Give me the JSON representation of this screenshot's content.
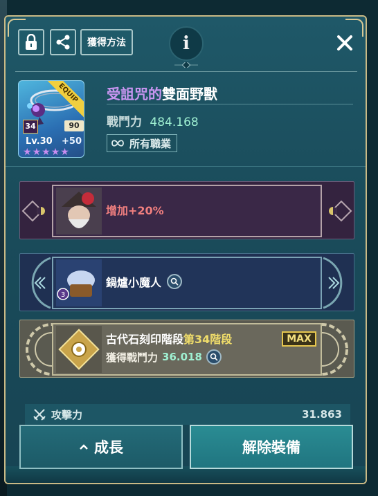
{
  "toolbar": {
    "acquire_label": "獲得方法",
    "info_label": "i"
  },
  "item": {
    "name_cursed": "受詛咒的",
    "name_rest": "雙面野獸",
    "power_label": "戰鬥力",
    "power_value": "484.168",
    "class_label": "所有職業",
    "level_badge": "34",
    "upgrade_badge": "90",
    "level_text": "Lv.30",
    "plus_text": "+50",
    "equip_ribbon": "EQUIP",
    "stars": 5
  },
  "bars": {
    "bonus_text": "增加+20%",
    "pet_name": "鍋爐小魔人",
    "pet_level": "3",
    "stage_prefix": "古代石刻印階段",
    "stage_highlight": "第34階段",
    "max_label": "MAX",
    "gain_label": "獲得戰鬥力",
    "gain_value": "36.018"
  },
  "stats": {
    "attack_label": "攻擊力",
    "attack_value": "31.863"
  },
  "buttons": {
    "grow_label": "成長",
    "unequip_label": "解除裝備"
  },
  "colors": {
    "panel_bg": "#1a4c5b",
    "gold_border": "#c9b985",
    "cursed_purple": "#c795f0",
    "power_green": "#9ff0d2",
    "bonus_red": "#f07f7f",
    "stage_yellow": "#f0dd6a"
  }
}
